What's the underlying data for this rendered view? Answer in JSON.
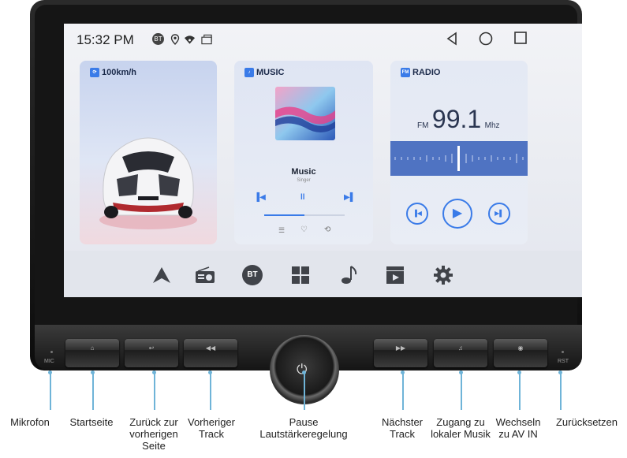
{
  "status": {
    "time": "15:32 PM",
    "bt_badge": "BT"
  },
  "cards": {
    "speed": {
      "title": "100km/h"
    },
    "music": {
      "title": "MUSIC",
      "track": "Music",
      "artist": "Singer"
    },
    "radio": {
      "title": "RADIO",
      "band": "FM",
      "frequency": "99.1",
      "unit": "Mhz"
    }
  },
  "dock": {
    "bt_label": "BT"
  },
  "hardware": {
    "mic": "MIC",
    "rst": "RST"
  },
  "labels": {
    "mikrofon": "Mikrofon",
    "startseite": "Startseite",
    "zurueck": "Zurück zur vorherigen Seite",
    "vorheriger": "Vorheriger Track",
    "pause": "Pause Lautstärkeregelung",
    "naechster": "Nächster Track",
    "musik": "Zugang zu lokaler Musik",
    "av": "Wechseln zu AV IN",
    "reset": "Zurücksetzen"
  },
  "colors": {
    "accent": "#3a7be8",
    "radio_band": "#4f73c2",
    "callout": "#6fb4d8"
  }
}
